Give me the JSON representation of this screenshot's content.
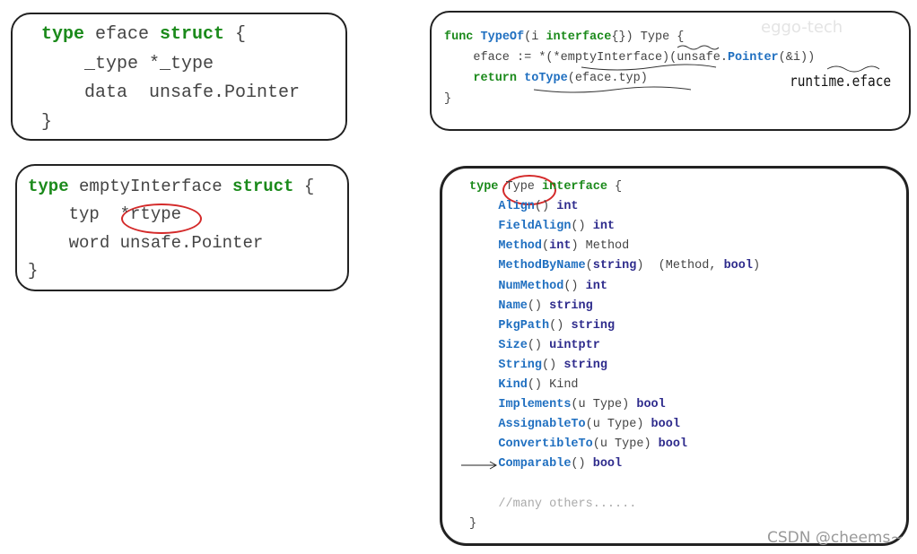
{
  "colors": {
    "keyword": "#1b8a1b",
    "function": "#1f6fc0",
    "type": "#2e2b8c",
    "plain": "#444444",
    "comment": "#aaaaaa",
    "highlight_circle": "#d42a2a"
  },
  "boxes": [
    {
      "name": "eface-struct",
      "lines": [
        [
          [
            "kw",
            "type"
          ],
          [
            "pl",
            " eface "
          ],
          [
            "kw",
            "struct"
          ],
          [
            "pl",
            " {"
          ]
        ],
        [
          [
            "pl",
            "    _type *_type"
          ]
        ],
        [
          [
            "pl",
            "    data  unsafe.Pointer"
          ]
        ],
        [
          [
            "pl",
            "}"
          ]
        ]
      ]
    },
    {
      "name": "empty-interface-struct",
      "lines": [
        [
          [
            "kw",
            "type"
          ],
          [
            "pl",
            " emptyInterface "
          ],
          [
            "kw",
            "struct"
          ],
          [
            "pl",
            " {"
          ]
        ],
        [
          [
            "pl",
            "    typ  *rtype"
          ]
        ],
        [
          [
            "pl",
            "    word unsafe.Pointer"
          ]
        ],
        [
          [
            "pl",
            "}"
          ]
        ]
      ]
    },
    {
      "name": "typeof-func",
      "lines": [
        [
          [
            "kw",
            "func "
          ],
          [
            "fn",
            "TypeOf"
          ],
          [
            "pl",
            "(i "
          ],
          [
            "kw",
            "interface"
          ],
          [
            "pl",
            "{}) Type {"
          ]
        ],
        [
          [
            "pl",
            "    eface := *(*emptyInterface)(unsafe."
          ],
          [
            "fn",
            "Pointer"
          ],
          [
            "pl",
            "(&i))"
          ]
        ],
        [
          [
            "kw",
            "    return "
          ],
          [
            "fn",
            "toType"
          ],
          [
            "pl",
            "(eface.typ)"
          ]
        ],
        [
          [
            "pl",
            "}"
          ]
        ]
      ]
    },
    {
      "name": "type-interface",
      "lines": [
        [
          [
            "kw",
            "type"
          ],
          [
            "pl",
            " Type "
          ],
          [
            "kw",
            "interface"
          ],
          [
            "pl",
            " {"
          ]
        ],
        [
          [
            "fn",
            "    Align"
          ],
          [
            "pl",
            "() "
          ],
          [
            "ty",
            "int"
          ]
        ],
        [
          [
            "fn",
            "    FieldAlign"
          ],
          [
            "pl",
            "() "
          ],
          [
            "ty",
            "int"
          ]
        ],
        [
          [
            "fn",
            "    Method"
          ],
          [
            "pl",
            "("
          ],
          [
            "ty",
            "int"
          ],
          [
            "pl",
            ") Method"
          ]
        ],
        [
          [
            "fn",
            "    MethodByName"
          ],
          [
            "pl",
            "("
          ],
          [
            "ty",
            "string"
          ],
          [
            "pl",
            ")  (Method, "
          ],
          [
            "ty",
            "bool"
          ],
          [
            "pl",
            ")"
          ]
        ],
        [
          [
            "fn",
            "    NumMethod"
          ],
          [
            "pl",
            "() "
          ],
          [
            "ty",
            "int"
          ]
        ],
        [
          [
            "fn",
            "    Name"
          ],
          [
            "pl",
            "() "
          ],
          [
            "ty",
            "string"
          ]
        ],
        [
          [
            "fn",
            "    PkgPath"
          ],
          [
            "pl",
            "() "
          ],
          [
            "ty",
            "string"
          ]
        ],
        [
          [
            "fn",
            "    Size"
          ],
          [
            "pl",
            "() "
          ],
          [
            "ty",
            "uintptr"
          ]
        ],
        [
          [
            "fn",
            "    String"
          ],
          [
            "pl",
            "() "
          ],
          [
            "ty",
            "string"
          ]
        ],
        [
          [
            "fn",
            "    Kind"
          ],
          [
            "pl",
            "() Kind"
          ]
        ],
        [
          [
            "fn",
            "    Implements"
          ],
          [
            "pl",
            "(u Type) "
          ],
          [
            "ty",
            "bool"
          ]
        ],
        [
          [
            "fn",
            "    AssignableTo"
          ],
          [
            "pl",
            "(u Type) "
          ],
          [
            "ty",
            "bool"
          ]
        ],
        [
          [
            "fn",
            "    ConvertibleTo"
          ],
          [
            "pl",
            "(u Type) "
          ],
          [
            "ty",
            "bool"
          ]
        ],
        [
          [
            "fn",
            "    Comparable"
          ],
          [
            "pl",
            "() "
          ],
          [
            "ty",
            "bool"
          ]
        ],
        [
          [
            "pl",
            ""
          ]
        ],
        [
          [
            "cm",
            "    //many others......"
          ]
        ],
        [
          [
            "pl",
            "}"
          ]
        ]
      ]
    }
  ],
  "annotation": "runtime.eface",
  "watermarks": {
    "csdn": "CSDN @cheems~",
    "logo": "eggo-tech"
  }
}
